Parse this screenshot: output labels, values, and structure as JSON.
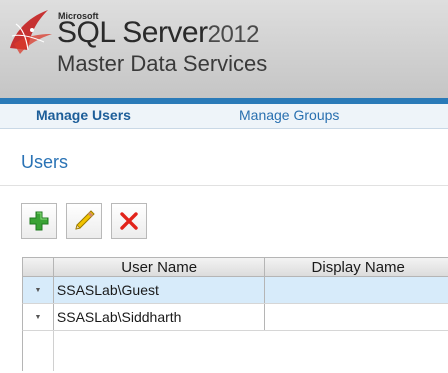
{
  "banner": {
    "brand_small": "Microsoft",
    "product_name": "SQL Server",
    "product_year": "2012",
    "subtitle": "Master Data Services",
    "background_color": "#d0d0d0",
    "accent_rule_color": "#2a7ab8",
    "logo_icon": "sql-server-logo-icon"
  },
  "nav": {
    "tabs": [
      {
        "label": "Manage Users",
        "active": true
      },
      {
        "label": "Manage Groups",
        "active": false
      }
    ]
  },
  "page": {
    "title": "Users"
  },
  "toolbar": {
    "buttons": [
      {
        "icon": "add-icon",
        "color": "#3aa335"
      },
      {
        "icon": "pencil-icon",
        "color": "#e0b400"
      },
      {
        "icon": "delete-icon",
        "color": "#e2231a"
      }
    ]
  },
  "grid": {
    "columns": [
      "User Name",
      "Display Name"
    ],
    "rows": [
      {
        "user_name": "SSASLab\\Guest",
        "display_name": "",
        "selected": true
      },
      {
        "user_name": "SSASLab\\Siddharth",
        "display_name": "",
        "selected": false
      }
    ],
    "row_marker_icon": "row-expand-caret-icon",
    "selected_row_color": "#d7ebfa"
  }
}
